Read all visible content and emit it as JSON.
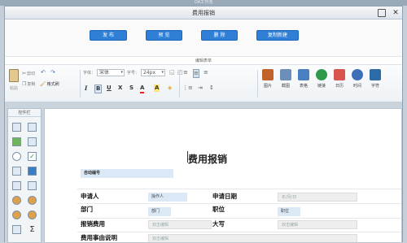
{
  "outer": {
    "title": "OA工作流"
  },
  "window": {
    "title": "费用报销"
  },
  "actions": [
    {
      "label": "发 布"
    },
    {
      "label": "预 览"
    },
    {
      "label": "删 除"
    },
    {
      "label": "复制新建"
    }
  ],
  "ribbon": {
    "group_label": "编辑表单",
    "clipboard": {
      "paste": "粘贴",
      "cut": "剪切",
      "copy": "复制",
      "format_painter": "格式刷"
    },
    "font_label": "字体：",
    "font_value": "宋体",
    "size_label": "字号：",
    "size_value": "24px",
    "format_glyphs": {
      "italic": "I",
      "bold": "B",
      "underline": "U",
      "strike": "X",
      "superscript": "S",
      "color": "A",
      "highlight": "A"
    },
    "insert": [
      {
        "label": "图片",
        "color": "#c0622a"
      },
      {
        "label": "截图",
        "color": "#6b8fb8"
      },
      {
        "label": "表格",
        "color": "#4a7fc1"
      },
      {
        "label": "链接",
        "color": "#2f9a4c"
      },
      {
        "label": "日历",
        "color": "#d9534f"
      },
      {
        "label": "时间",
        "color": "#3c6fb5"
      },
      {
        "label": "字符",
        "color": "#2d6aa8"
      }
    ]
  },
  "palette": {
    "title": "控件栏",
    "glyph_sigma": "Σ"
  },
  "document": {
    "title": "费用报销",
    "auto_number": "自动编号",
    "rows": [
      {
        "label": "申请人",
        "field": "操作人",
        "label2": "申请日期",
        "field2": "年/月/日"
      },
      {
        "label": "部门",
        "field": "部门",
        "label2": "职位",
        "field2": "职位"
      },
      {
        "label": "报销费用",
        "field": "双击编辑",
        "label2": "大写",
        "field2": "双击编辑"
      },
      {
        "label": "费用事由说明",
        "field": "双击编辑"
      }
    ]
  },
  "colors": {
    "accent": "#2f7fd6",
    "workspace": "#c9d3dc"
  }
}
